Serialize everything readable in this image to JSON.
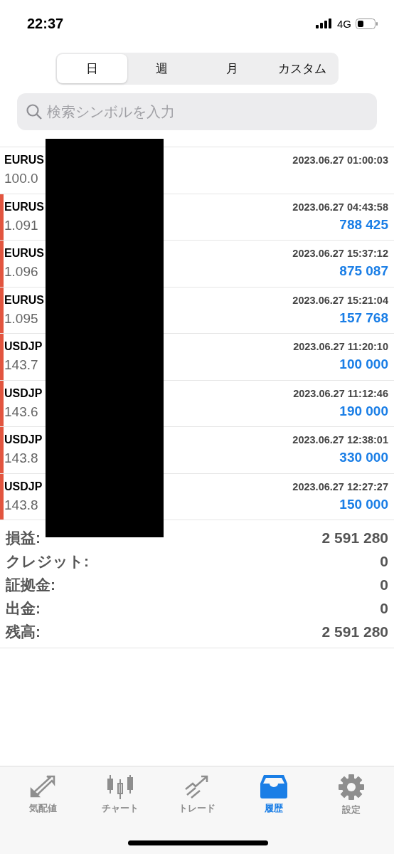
{
  "status_bar": {
    "time": "22:37",
    "network": "4G"
  },
  "period_tabs": [
    {
      "label": "日",
      "selected": true
    },
    {
      "label": "週",
      "selected": false
    },
    {
      "label": "月",
      "selected": false
    },
    {
      "label": "カスタム",
      "selected": false
    }
  ],
  "search": {
    "placeholder": "検索シンボルを入力"
  },
  "redaction": true,
  "deals": [
    {
      "symbol": "EURUS",
      "price": "100.0",
      "time": "2023.06.27 01:00:03"
    },
    {
      "symbol": "EURUS",
      "price": "1.091",
      "time": "2023.06.27 04:43:58",
      "profit": "788 425",
      "color": "#e2553f"
    },
    {
      "symbol": "EURUS",
      "price": "1.096",
      "time": "2023.06.27 15:37:12",
      "profit": "875 087",
      "color": "#e2553f"
    },
    {
      "symbol": "EURUS",
      "price": "1.095",
      "time": "2023.06.27 15:21:04",
      "profit": "157 768",
      "color": "#e2553f"
    },
    {
      "symbol": "USDJP",
      "price": "143.7",
      "time": "2023.06.27 11:20:10",
      "profit": "100 000",
      "color": "#e2553f"
    },
    {
      "symbol": "USDJP",
      "price": "143.6",
      "time": "2023.06.27 11:12:46",
      "profit": "190 000",
      "color": "#e2553f"
    },
    {
      "symbol": "USDJP",
      "price": "143.8",
      "time": "2023.06.27 12:38:01",
      "profit": "330 000",
      "color": "#e2553f"
    },
    {
      "symbol": "USDJP",
      "price": "143.8",
      "time": "2023.06.27 12:27:27",
      "profit": "150 000",
      "color": "#e2553f"
    }
  ],
  "summary": [
    {
      "label": "損益:",
      "value": "2 591 280"
    },
    {
      "label": "クレジット:",
      "value": "0"
    },
    {
      "label": "証拠金:",
      "value": "0"
    },
    {
      "label": "出金:",
      "value": "0"
    },
    {
      "label": "残高:",
      "value": "2 591 280"
    }
  ],
  "tab_bar": [
    {
      "kind": "quotes",
      "label": "気配値",
      "selected": false
    },
    {
      "kind": "chart",
      "label": "チャート",
      "selected": false
    },
    {
      "kind": "trade",
      "label": "トレード",
      "selected": false
    },
    {
      "kind": "history",
      "label": "履歴",
      "selected": true
    },
    {
      "kind": "settings",
      "label": "設定",
      "selected": false
    }
  ]
}
